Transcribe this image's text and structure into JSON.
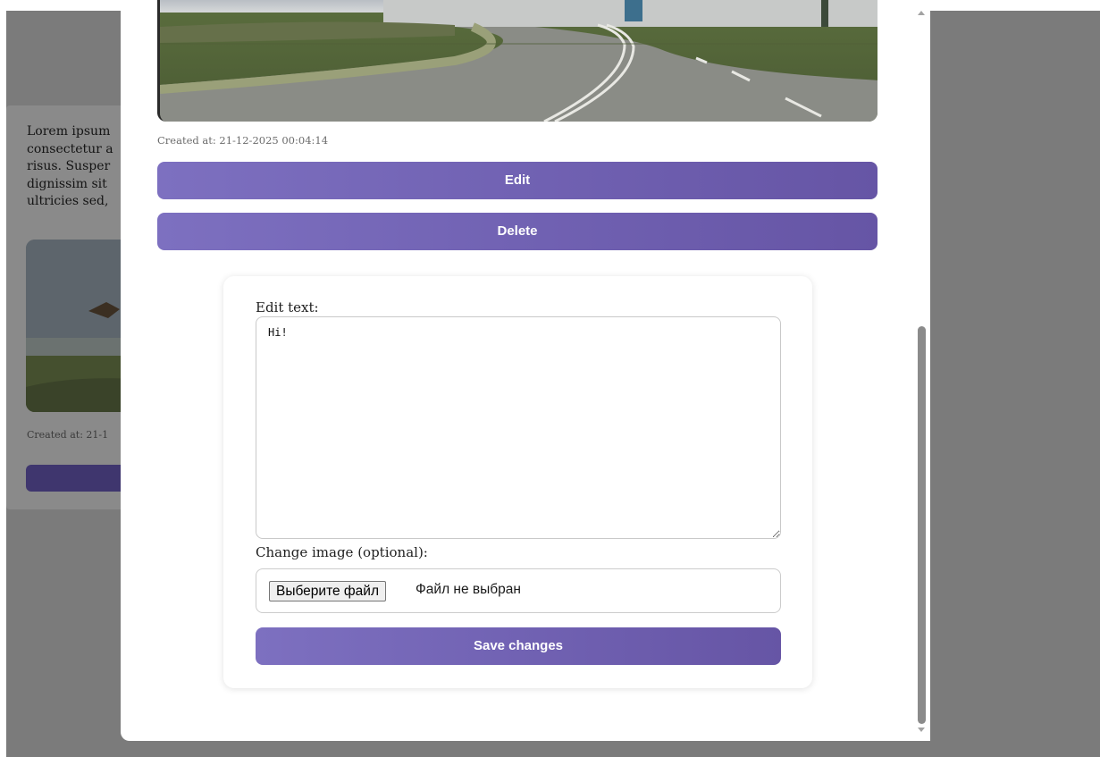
{
  "background_card": {
    "text_lines": [
      "Lorem ipsum",
      "consectetur a",
      "risus. Susper",
      "dignissim sit",
      "ultricies sed,"
    ],
    "created_at": "Created at: 21-1"
  },
  "modal": {
    "post": {
      "image_icon": "road-photo-image",
      "created_at": "Created at: 21-12-2025 00:04:14",
      "edit_label": "Edit",
      "delete_label": "Delete"
    },
    "edit_form": {
      "text_label": "Edit text:",
      "text_value": "Hi!",
      "image_label": "Change image (optional):",
      "file_button_label": "Выберите файл",
      "file_status": "Файл не выбран",
      "save_label": "Save changes"
    }
  },
  "colors": {
    "button_gradient_start": "#7d70c0",
    "button_gradient_end": "#6655a5",
    "overlay": "#7b7b7b"
  }
}
